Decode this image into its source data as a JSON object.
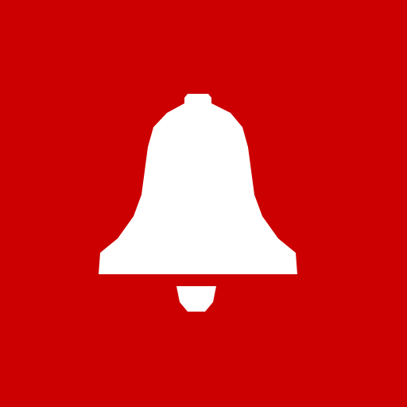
{
  "icon": {
    "name": "bell-icon",
    "background_color": "#cc0000",
    "glyph_color": "#ffffff"
  }
}
